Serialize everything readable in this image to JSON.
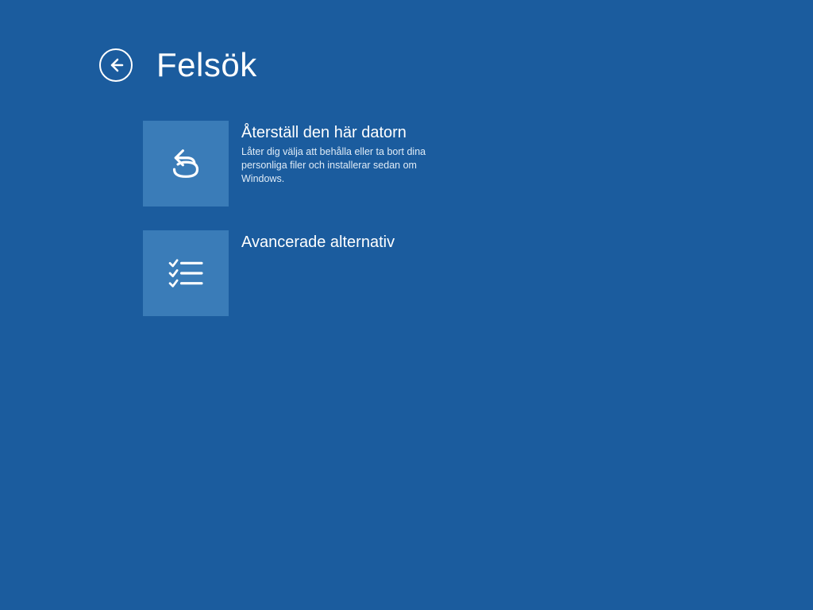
{
  "header": {
    "title": "Felsök"
  },
  "options": [
    {
      "title": "Återställ den här datorn",
      "description": "Låter dig välja att behålla eller ta bort dina personliga filer och installerar sedan om Windows."
    },
    {
      "title": "Avancerade alternativ",
      "description": ""
    }
  ]
}
